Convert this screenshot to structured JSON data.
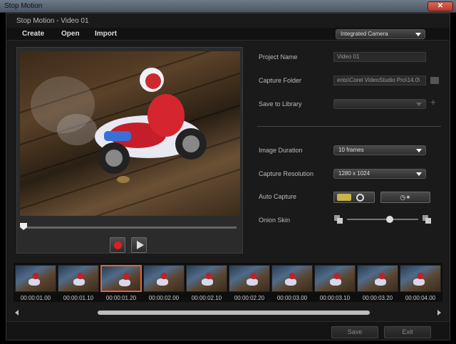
{
  "window": {
    "title": "Stop Motion",
    "close_label": "✕"
  },
  "document": {
    "title": "Stop Motion - Video 01"
  },
  "menu": {
    "create": "Create",
    "open": "Open",
    "import": "Import"
  },
  "camera_select": {
    "value": "Integrated Camera",
    "icon": "chevron-down-icon"
  },
  "properties": {
    "project_name": {
      "label": "Project Name",
      "value": "Video 01"
    },
    "capture_folder": {
      "label": "Capture Folder",
      "value": "ents\\Corel VideoStudio Pro\\14.0\\",
      "icon": "folder-icon"
    },
    "save_to_library": {
      "label": "Save to Library",
      "value": "",
      "icon": "plus-icon",
      "disabled": true
    },
    "image_duration": {
      "label": "Image Duration",
      "value": "10 frames"
    },
    "capture_resolution": {
      "label": "Capture Resolution",
      "value": "1280 x 1024"
    },
    "auto_capture": {
      "label": "Auto Capture",
      "on_icon": "toggle-on-icon",
      "off_icon": "toggle-off-icon",
      "timer_label": "◷✶",
      "timer_icon": "timer-settings-icon"
    },
    "onion_skin": {
      "label": "Onion Skin",
      "level": 0.6,
      "icon": "onion-skin-icon"
    }
  },
  "playback": {
    "progress": 0.0,
    "record_icon": "record-icon",
    "play_icon": "play-icon"
  },
  "filmstrip": {
    "selected_index": 2,
    "frames": [
      {
        "timecode": "00:00:01.00"
      },
      {
        "timecode": "00:00:01.10"
      },
      {
        "timecode": "00:00:01.20"
      },
      {
        "timecode": "00:00:02.00"
      },
      {
        "timecode": "00:00:02.10"
      },
      {
        "timecode": "00:00:02.20"
      },
      {
        "timecode": "00:00:03.00"
      },
      {
        "timecode": "00:00:03.10"
      },
      {
        "timecode": "00:00:03.20"
      },
      {
        "timecode": "00:00:04.00"
      }
    ]
  },
  "footer": {
    "save": "Save",
    "exit": "Exit"
  },
  "colors": {
    "accent_selected": "#e0643c",
    "record": "#e01e1e",
    "auto_capture_on": "#c9b34a"
  }
}
